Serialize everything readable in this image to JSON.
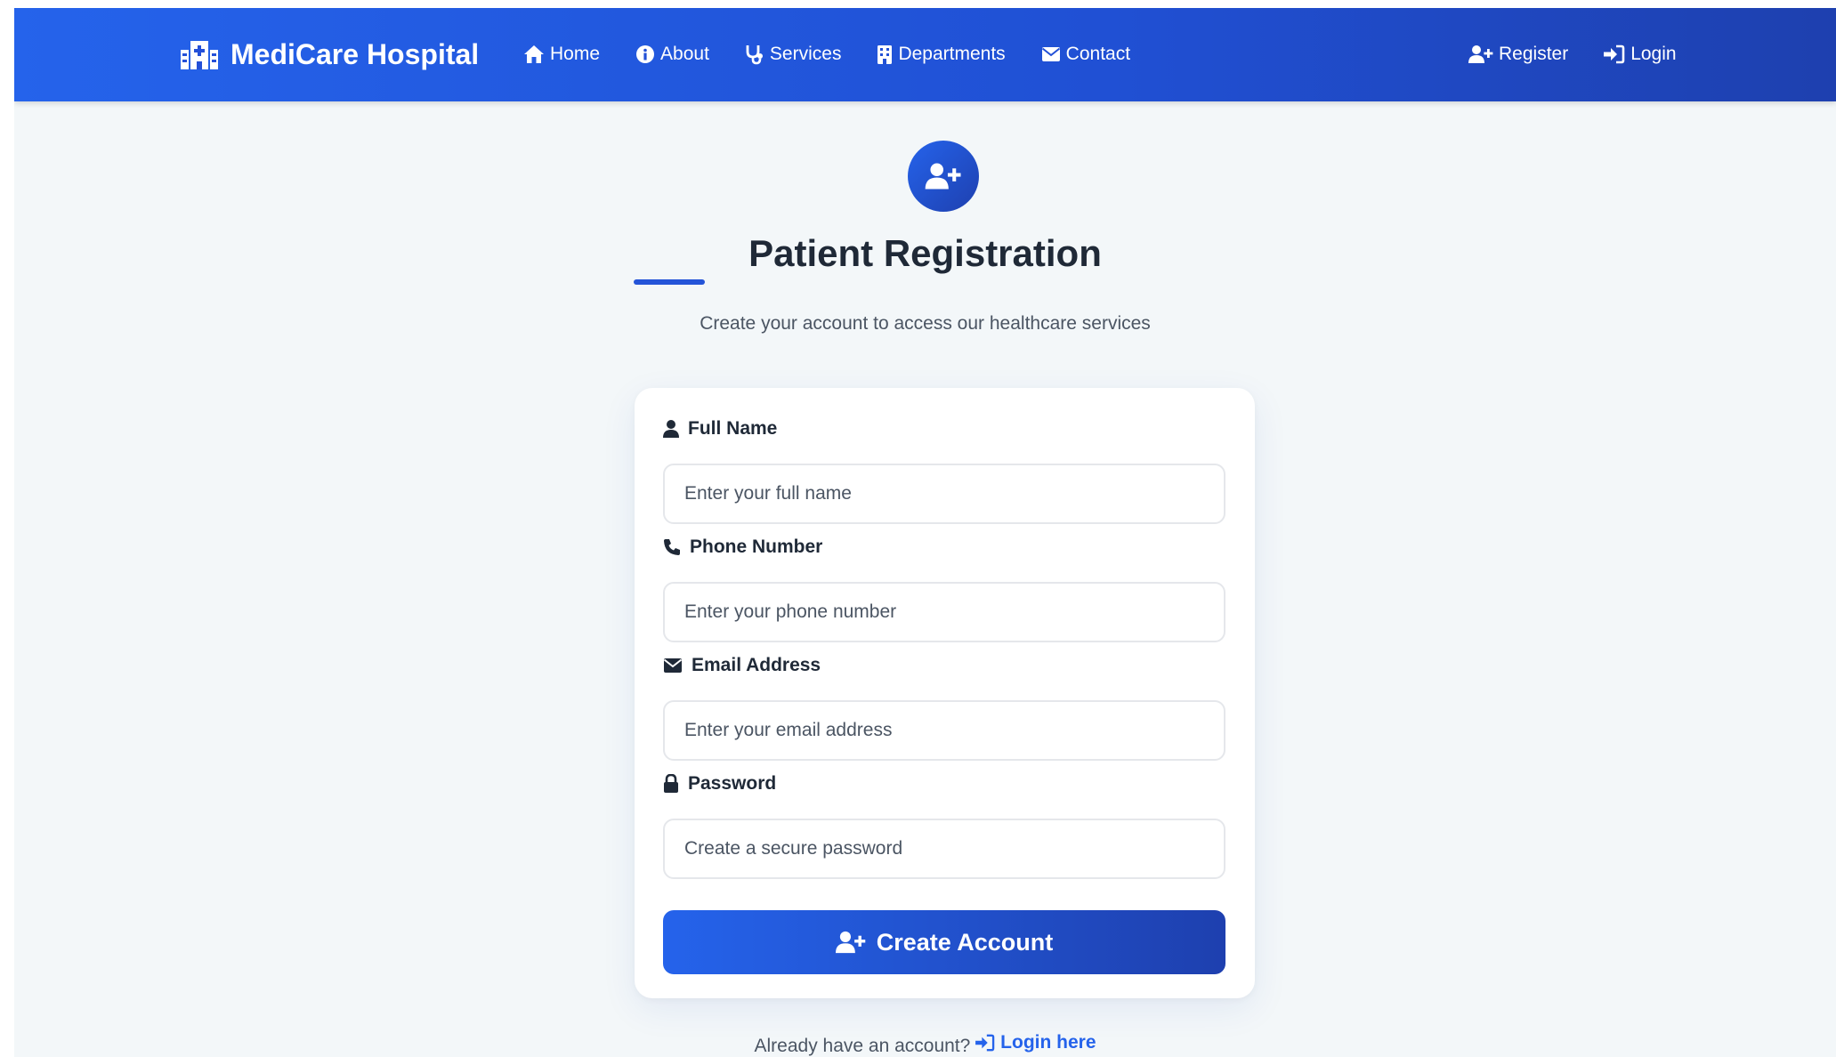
{
  "colors": {
    "primary": "#2563eb",
    "primary_dark": "#1e40af",
    "background": "#f3f7f9",
    "text": "#1f2937"
  },
  "navbar": {
    "brand": "MediCare Hospital",
    "brand_icon": "hospital-icon",
    "links": [
      {
        "label": "Home",
        "icon": "home-icon"
      },
      {
        "label": "About",
        "icon": "info-icon"
      },
      {
        "label": "Services",
        "icon": "stethoscope-icon"
      },
      {
        "label": "Departments",
        "icon": "building-icon"
      },
      {
        "label": "Contact",
        "icon": "envelope-icon"
      }
    ],
    "right_links": [
      {
        "label": "Register",
        "icon": "user-plus-icon"
      },
      {
        "label": "Login",
        "icon": "sign-in-icon"
      }
    ]
  },
  "header": {
    "icon": "user-plus-icon",
    "title": "Patient Registration",
    "subtitle": "Create your account to access our healthcare services"
  },
  "form": {
    "fields": [
      {
        "label": "Full Name",
        "icon": "user-icon",
        "placeholder": "Enter your full name",
        "value": ""
      },
      {
        "label": "Phone Number",
        "icon": "phone-icon",
        "placeholder": "Enter your phone number",
        "value": ""
      },
      {
        "label": "Email Address",
        "icon": "envelope-icon",
        "placeholder": "Enter your email address",
        "value": ""
      },
      {
        "label": "Password",
        "icon": "lock-icon",
        "placeholder": "Create a secure password",
        "value": ""
      }
    ],
    "submit_label": "Create Account"
  },
  "footer": {
    "prompt": "Already have an account?",
    "link_label": "Login here"
  }
}
